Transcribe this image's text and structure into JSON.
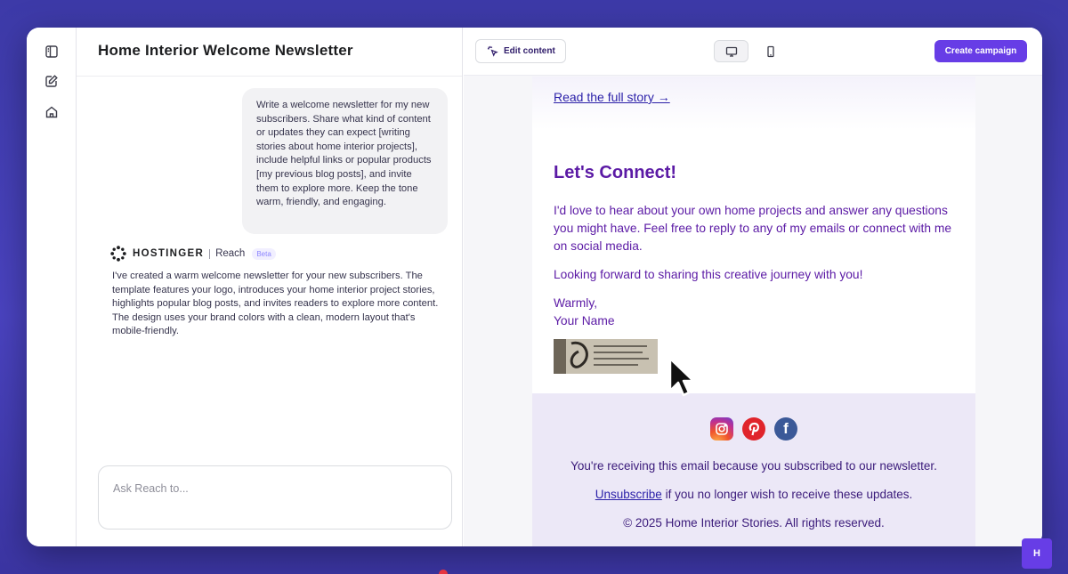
{
  "header": {
    "title": "Home Interior Welcome Newsletter",
    "edit_label": "Edit content",
    "create_label": "Create campaign"
  },
  "chat": {
    "user_message": "Write a welcome newsletter for my new subscribers. Share what kind of content or updates they can expect [writing stories about home interior projects], include helpful links or popular products [my previous blog posts], and invite them to explore more. Keep the tone warm, friendly, and engaging.",
    "brand_name": "HOSTINGER",
    "brand_product": "Reach",
    "beta_label": "Beta",
    "assistant_message": "I've created a warm welcome newsletter for your new subscribers. The template features your logo, introduces your home interior project stories, highlights popular blog posts, and invites readers to explore more content. The design uses your brand colors with a clean, modern layout that's mobile-friendly.",
    "input_placeholder": "Ask Reach to..."
  },
  "email": {
    "read_link": "Read the full story →",
    "connect_heading": "Let's Connect!",
    "connect_body": "I'd love to hear about your own home projects and answer any questions you might have. Feel free to reply to any of my emails or connect with me on social media.",
    "closing_line": "Looking forward to sharing this creative journey with you!",
    "signoff": "Warmly,",
    "name": "Your Name",
    "footer_subscribed": "You're receiving this email because you subscribed to our newsletter.",
    "unsubscribe_link": "Unsubscribe",
    "unsubscribe_rest": " if you no longer wish to receive these updates.",
    "copyright": "© 2025 Home Interior Stories. All rights reserved."
  },
  "colors": {
    "accent": "#673de6",
    "email_text": "#5b1aa5",
    "footer_bg": "#ece8f7"
  },
  "icons": {
    "rail": [
      "sidebar-toggle-icon",
      "edit-icon",
      "home-icon"
    ],
    "device": [
      "desktop-icon",
      "mobile-icon"
    ],
    "social": [
      "instagram-icon",
      "pinterest-icon",
      "facebook-icon"
    ]
  }
}
